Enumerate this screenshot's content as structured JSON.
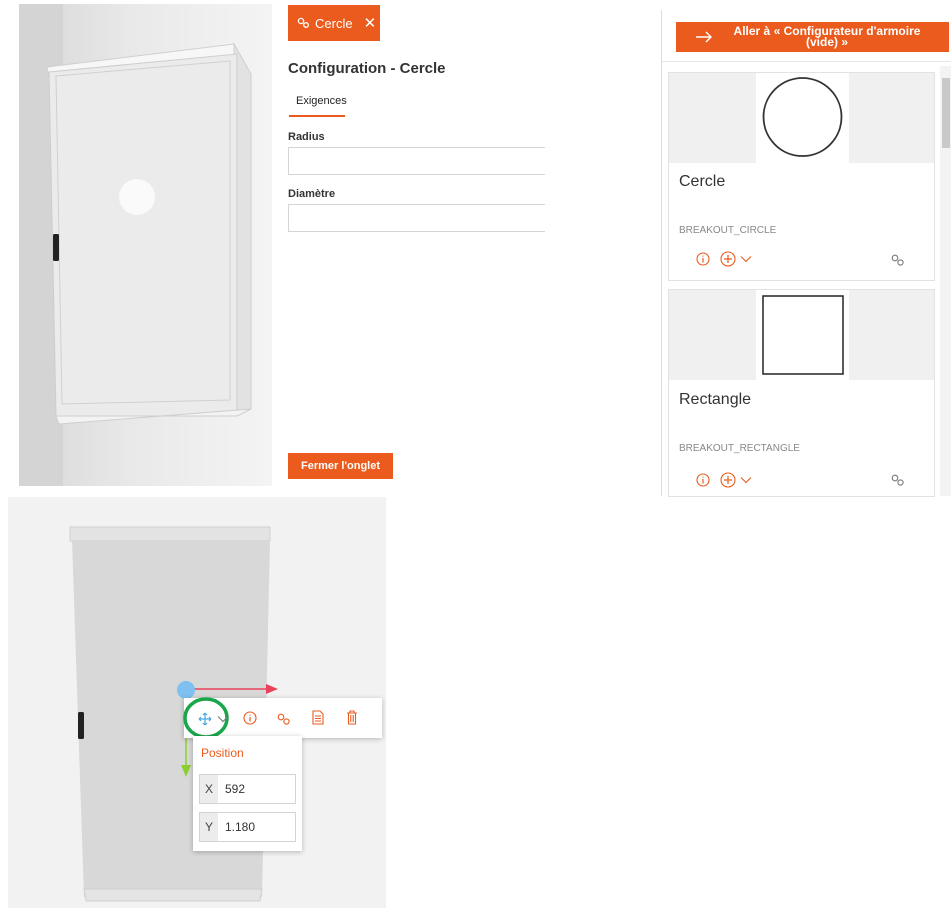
{
  "config_panel": {
    "tab_label": "Cercle",
    "title": "Configuration - Cercle",
    "requirements_tab": "Exigences",
    "fields": [
      {
        "label": "Radius",
        "value": ""
      },
      {
        "label": "Diamètre",
        "value": ""
      }
    ],
    "close_button": "Fermer l'onglet"
  },
  "catalog": {
    "goto_button": "Aller à « Configurateur d'armoire (vide) »",
    "items": [
      {
        "name": "Cercle",
        "code": "BREAKOUT_CIRCLE",
        "shape": "circle"
      },
      {
        "name": "Rectangle",
        "code": "BREAKOUT_RECTANGLE",
        "shape": "square"
      }
    ]
  },
  "toolbar": {
    "icons": [
      "move-icon",
      "chevron-down-icon",
      "info-icon",
      "gears-icon",
      "document-icon",
      "trash-icon"
    ]
  },
  "position_panel": {
    "title": "Position",
    "x_label": "X",
    "x_value": "592",
    "y_label": "Y",
    "y_value": "1.180"
  },
  "colors": {
    "accent": "#ea5b1d",
    "highlight_ring": "#1aa64a",
    "gizmo_x": "#e8435a",
    "gizmo_y": "#8ccf2f",
    "gizmo_handle": "#7ec0ef"
  }
}
